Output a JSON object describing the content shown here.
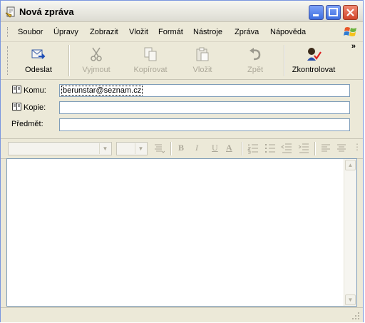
{
  "window": {
    "title": "Nová zpráva"
  },
  "menu": {
    "items": [
      "Soubor",
      "Úpravy",
      "Zobrazit",
      "Vložit",
      "Formát",
      "Nástroje",
      "Zpráva",
      "Nápověda"
    ]
  },
  "toolbar": {
    "send": "Odeslat",
    "cut": "Vyjmout",
    "copy": "Kopírovat",
    "paste": "Vložit",
    "undo": "Zpět",
    "check": "Zkontrolovat",
    "more": "»"
  },
  "fields": {
    "to_label": "Komu:",
    "to_value": "berunstar@seznam.cz",
    "cc_label": "Kopie:",
    "cc_value": "",
    "subject_label": "Předmět:",
    "subject_value": ""
  },
  "format": {
    "font": "",
    "size": "",
    "bold": "B",
    "italic": "I",
    "underline": "U",
    "color": "A"
  },
  "body": {
    "text": ""
  },
  "colors": {
    "title_bar": "#f6f6f2",
    "close_button": "#d2452a",
    "disabled": "#aca899"
  }
}
